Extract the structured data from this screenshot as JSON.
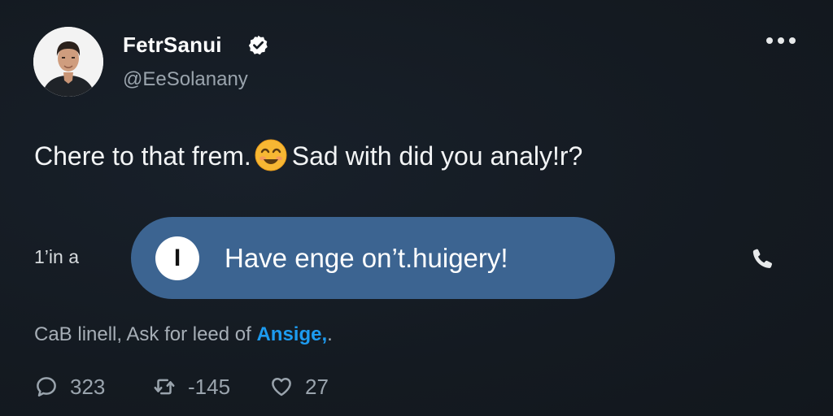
{
  "author": {
    "name": "FetrSanui",
    "handle": "@EeSolanany",
    "verified": true,
    "avatar": "profile-photo"
  },
  "tweet": {
    "text_before_emoji": "Chere to that frem.",
    "emoji": "smiling-face-with-smiling-eyes",
    "text_after_emoji": "Sad with did you analy!r?"
  },
  "reply_row": {
    "side_label": "1’in a",
    "pill_initial": "I",
    "pill_text": "Have enge on’t.huigery!",
    "pill_color": "#3c6491",
    "call_icon": "phone-icon"
  },
  "footer": {
    "text": "CaB linell, Ask for leed of ",
    "link": "Ansige,",
    "trailing": ".",
    "link_color": "#1d9bf0"
  },
  "actions": {
    "replies": "323",
    "retweets": "-145",
    "likes": "27"
  },
  "menu": {
    "icon": "more-horizontal-icon"
  }
}
